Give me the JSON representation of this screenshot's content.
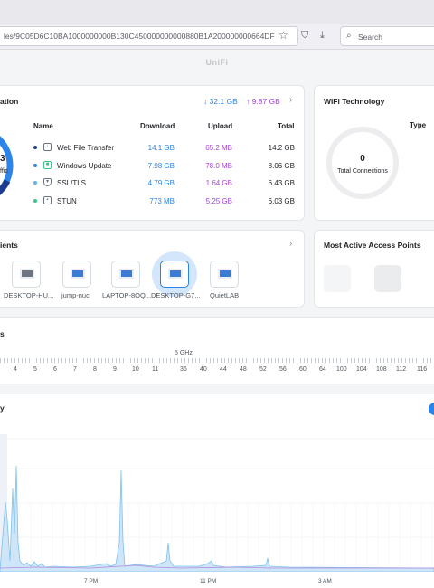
{
  "browser": {
    "url": "les/9C05D6C10BA1000000000B130C450000000000880B1A200000000664DF",
    "search_placeholder": "Search"
  },
  "app": {
    "title": "UniFi"
  },
  "application_card": {
    "title": "ation",
    "total_download": "↓ 32.1 GB",
    "total_upload": "↑ 9.87 GB",
    "donut_partial_num": "3",
    "donut_partial_lbl": "ffic",
    "columns": {
      "name": "Name",
      "download": "Download",
      "upload": "Upload",
      "total": "Total"
    },
    "rows": [
      {
        "name": "Web File Transfer",
        "download": "14.1 GB",
        "upload": "65.2 MB",
        "total": "14.2 GB",
        "dot": "#1d3b8f"
      },
      {
        "name": "Windows Update",
        "download": "7.98 GB",
        "upload": "78.0 MB",
        "total": "8.06 GB",
        "dot": "#2a84e9"
      },
      {
        "name": "SSL/TLS",
        "download": "4.79 GB",
        "upload": "1.64 GB",
        "total": "6.43 GB",
        "dot": "#5fb3ec"
      },
      {
        "name": "STUN",
        "download": "773 MB",
        "upload": "5.25 GB",
        "total": "6.03 GB",
        "dot": "#3cc48c"
      }
    ]
  },
  "wifi_card": {
    "title": "WiFi Technology",
    "type_label": "Type",
    "connections": "0",
    "connections_label": "Total Connections"
  },
  "clients_card": {
    "title": "ients",
    "clients": [
      {
        "label": "DESKTOP-HU..."
      },
      {
        "label": "jump-nuc"
      },
      {
        "label": "LAPTOP-8OQ..."
      },
      {
        "label": "DESKTOP-G7..."
      },
      {
        "label": "QuietLAB"
      }
    ]
  },
  "ap_card": {
    "title": "Most Active Access Points"
  },
  "channels_card": {
    "title": "s",
    "band_5ghz": "5 GHz",
    "channels_24": [
      "4",
      "5",
      "6",
      "7",
      "8",
      "9",
      "10",
      "11"
    ],
    "channels_5": [
      "36",
      "40",
      "44",
      "48",
      "52",
      "56",
      "60",
      "64",
      "100",
      "104",
      "108",
      "112",
      "116"
    ]
  },
  "activity_card": {
    "title": "y",
    "x_labels": [
      "7 PM",
      "11 PM",
      "3 AM"
    ]
  }
}
